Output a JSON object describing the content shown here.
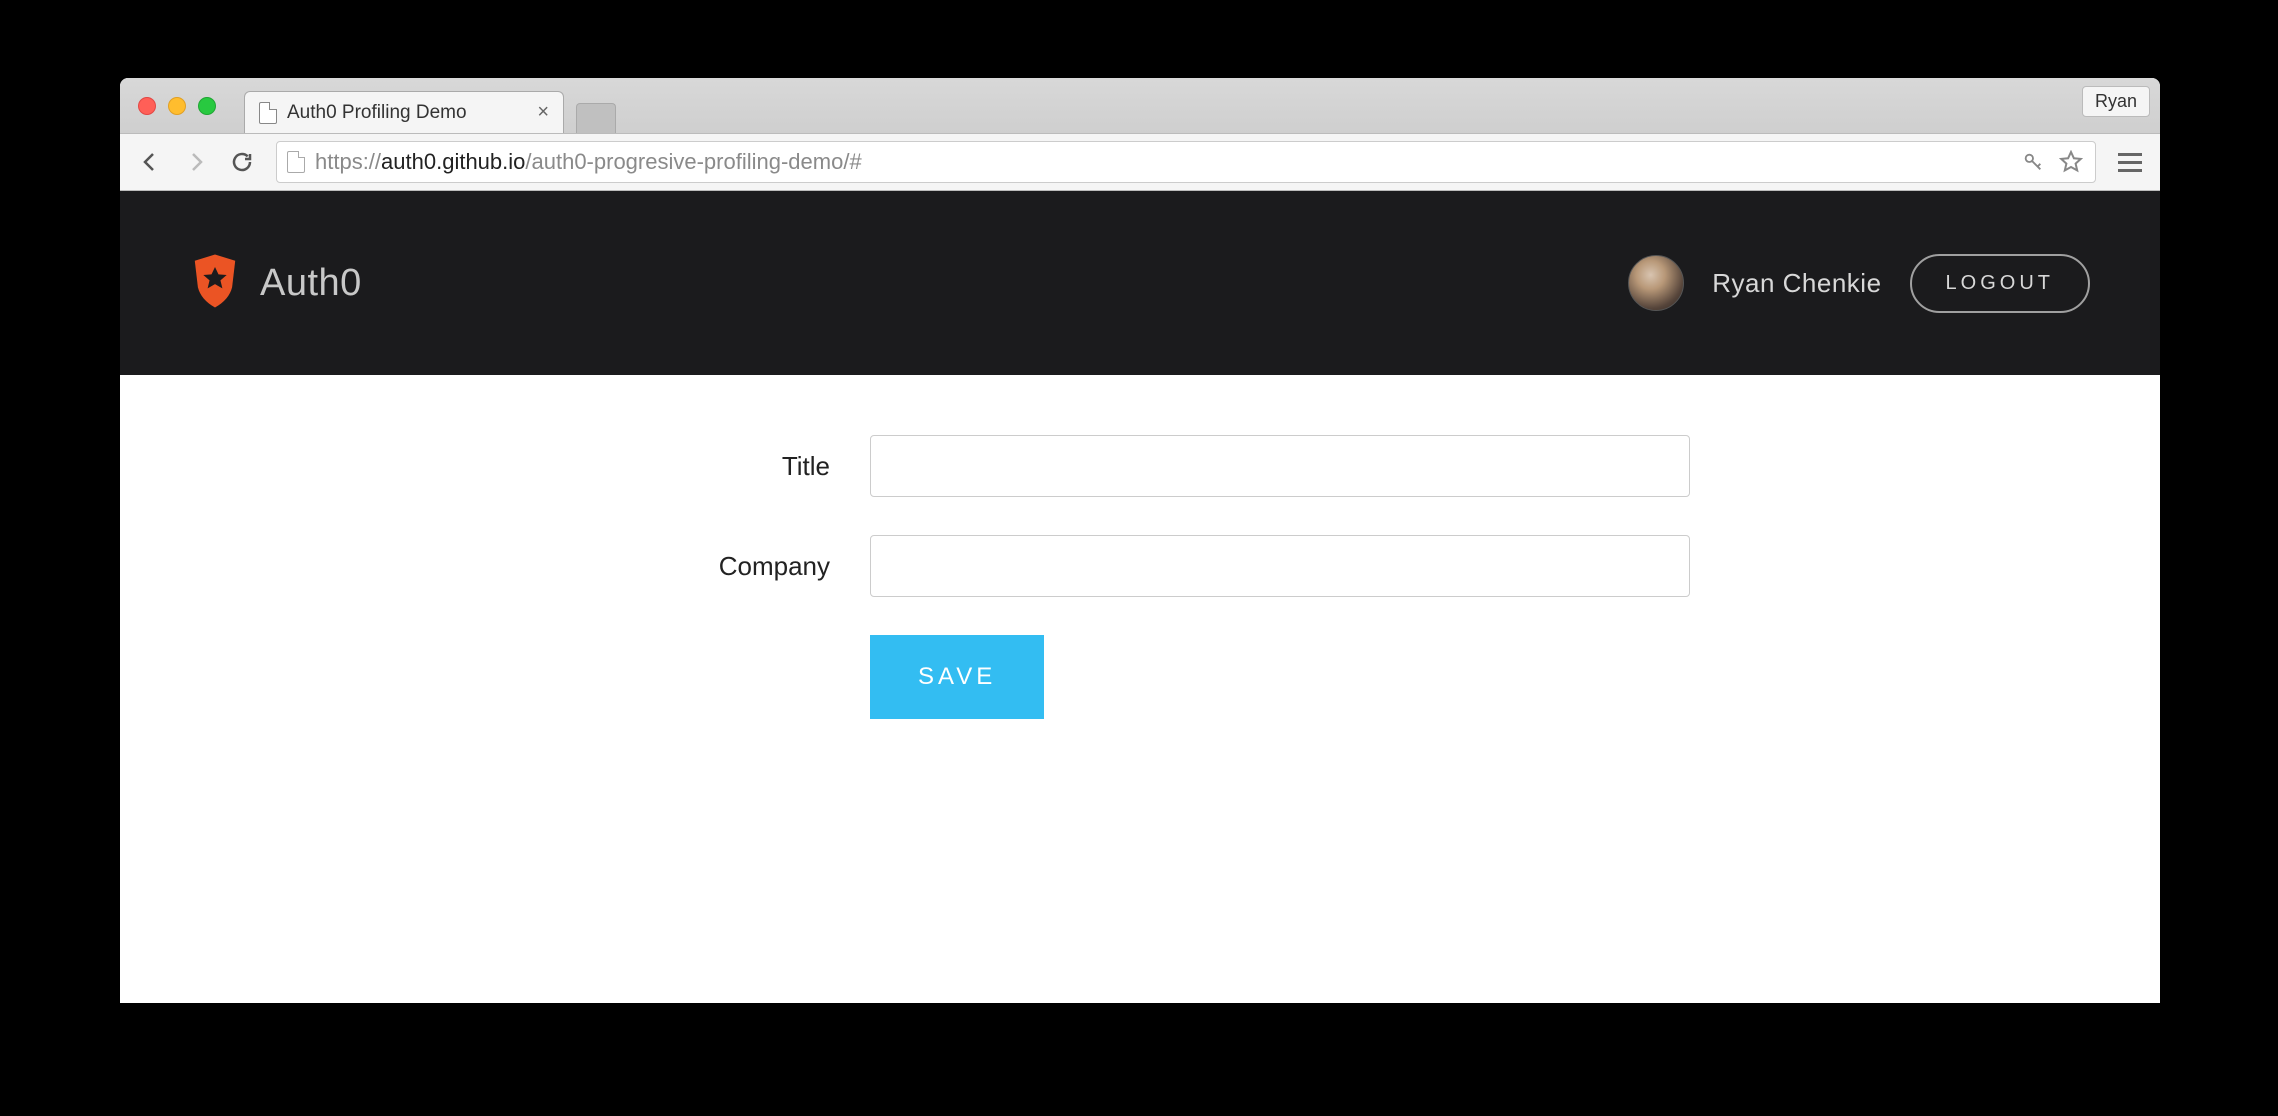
{
  "browser": {
    "tab_title": "Auth0 Profiling Demo",
    "profile_badge": "Ryan",
    "url_scheme": "https://",
    "url_host": "auth0.github.io",
    "url_path": "/auth0-progresive-profiling-demo/#"
  },
  "header": {
    "brand_name": "Auth0",
    "username": "Ryan Chenkie",
    "logout_label": "LOGOUT"
  },
  "form": {
    "fields": {
      "title": {
        "label": "Title",
        "value": ""
      },
      "company": {
        "label": "Company",
        "value": ""
      }
    },
    "save_label": "SAVE"
  },
  "colors": {
    "header_bg": "#1b1b1d",
    "accent_orange": "#eb5424",
    "button_blue": "#33bdf2"
  }
}
